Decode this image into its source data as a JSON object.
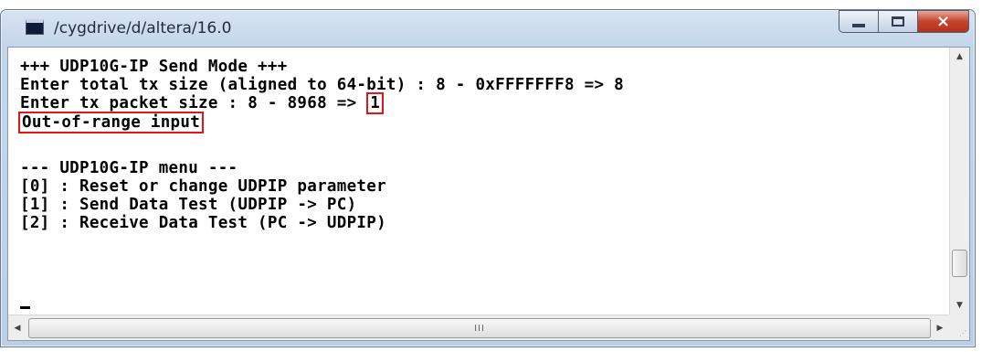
{
  "window": {
    "title": "/cygdrive/d/altera/16.0",
    "app_icon": "console-window-icon"
  },
  "controls": {
    "minimize_icon": "minimize-icon",
    "maximize_icon": "maximize-icon",
    "close_icon": "close-icon",
    "close_glyph": "×",
    "close_color": "#c4432a"
  },
  "console": {
    "lines": [
      "+++ UDP10G-IP Send Mode +++",
      "Enter total tx size (aligned to 64-bit) : 8 - 0xFFFFFFF8 => 8",
      "Enter tx packet size : 8 - 8968 => ",
      "1",
      "Out-of-range input",
      "--- UDP10G-IP menu ---",
      "[0] : Reset or change UDPIP parameter",
      "[1] : Send Data Test (UDPIP -> PC)",
      "[2] : Receive Data Test (PC -> UDPIP)"
    ],
    "text_color": "#000000",
    "highlight_color": "#e3151b"
  },
  "scrollbars": {
    "up_arrow": "▲",
    "down_arrow": "▼",
    "left_arrow": "◀",
    "right_arrow": "▶",
    "grip": "III",
    "size_grip": "⋰"
  }
}
